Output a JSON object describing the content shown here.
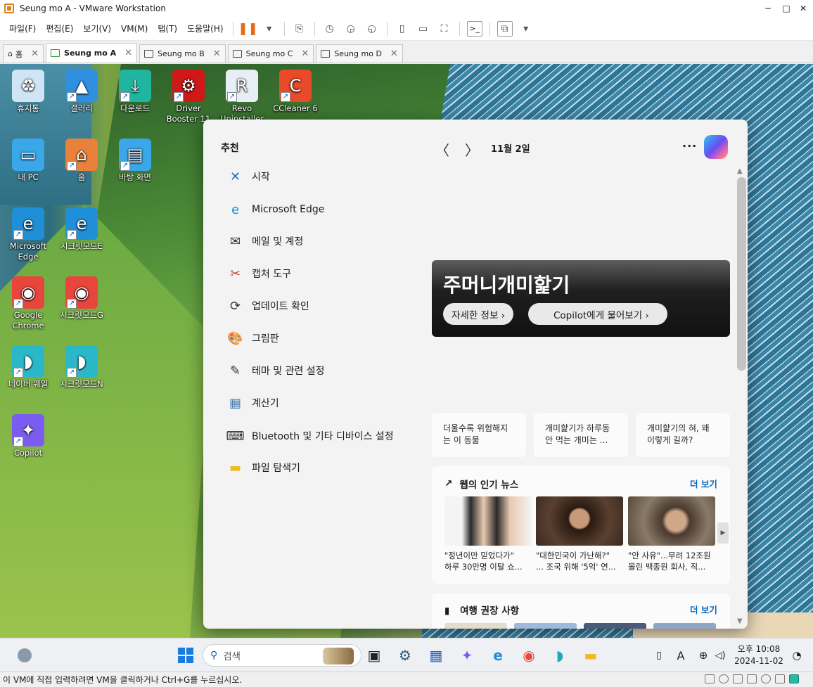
{
  "window": {
    "title": "Seung mo A - VMware Workstation",
    "minimize": "─",
    "maximize": "□",
    "close": "✕"
  },
  "menu": [
    "파일(F)",
    "편집(E)",
    "보기(V)",
    "VM(M)",
    "탭(T)",
    "도움말(H)"
  ],
  "toolbar": {
    "pause": "❚❚",
    "dropdown": "▾",
    "send_keys": "⎘",
    "snapshot": "◷",
    "revert": "◶",
    "manage": "◵",
    "view_full": "▯",
    "view_console": "▭",
    "fit": "⛶",
    "terminal": ">_",
    "unity": "⧉"
  },
  "tabs": [
    {
      "label": "홈",
      "icon": "home-icon"
    },
    {
      "label": "Seung mo A",
      "active": true
    },
    {
      "label": "Seung mo B"
    },
    {
      "label": "Seung mo C"
    },
    {
      "label": "Seung mo D"
    }
  ],
  "desktop_icons": [
    {
      "label": "휴지통",
      "icon": "recycle-bin-icon",
      "color": "#cfe4f4",
      "glyph": "♻"
    },
    {
      "label": "갤러리",
      "icon": "gallery-icon",
      "color": "#2f8fe0",
      "glyph": "▲"
    },
    {
      "label": "다운로드",
      "icon": "downloads-folder-icon",
      "color": "#1fb5a0",
      "glyph": "⤓"
    },
    {
      "label": "Driver Booster 11",
      "icon": "driver-booster-icon",
      "color": "#d01818",
      "glyph": "⚙"
    },
    {
      "label": "Revo Uninstaller",
      "icon": "revo-uninstaller-icon",
      "color": "#e8eef6",
      "glyph": "R"
    },
    {
      "label": "CCleaner 6",
      "icon": "ccleaner-icon",
      "color": "#e84a2a",
      "glyph": "C"
    },
    {
      "label": "내 PC",
      "icon": "this-pc-icon",
      "color": "#39a7e8",
      "glyph": "▭"
    },
    {
      "label": "홈",
      "icon": "home-icon",
      "color": "#e8823a",
      "glyph": "⌂"
    },
    {
      "label": "바탕 화면",
      "icon": "desktop-folder-icon",
      "color": "#39a7e8",
      "glyph": "▤"
    },
    {
      "label": "Microsoft Edge",
      "icon": "edge-icon",
      "color": "#1f8fd8",
      "glyph": "e"
    },
    {
      "label": "시크릿모드E",
      "icon": "edge-incognito-icon",
      "color": "#1f8fd8",
      "glyph": "e"
    },
    {
      "label": "Google Chrome",
      "icon": "chrome-icon",
      "color": "#e8453c",
      "glyph": "◉"
    },
    {
      "label": "시크릿모드G",
      "icon": "chrome-incognito-icon",
      "color": "#e8453c",
      "glyph": "◉"
    },
    {
      "label": "네이버 웨일",
      "icon": "naver-whale-icon",
      "color": "#2ab8c8",
      "glyph": "◗"
    },
    {
      "label": "시크릿모드N",
      "icon": "whale-incognito-icon",
      "color": "#2ab8c8",
      "glyph": "◗"
    },
    {
      "label": "Copilot",
      "icon": "copilot-icon",
      "color": "#7a5cf0",
      "glyph": "✦"
    }
  ],
  "start": {
    "recommended_title": "추천",
    "items": [
      {
        "label": "시작",
        "icon": "get-started-icon",
        "glyph": "✕",
        "color": "#1f6fd0"
      },
      {
        "label": "Microsoft Edge",
        "icon": "edge-icon",
        "glyph": "e",
        "color": "#1f8fd8"
      },
      {
        "label": "메일 및 계정",
        "icon": "mail-icon",
        "glyph": "✉",
        "color": "#333333"
      },
      {
        "label": "캡처 도구",
        "icon": "snipping-tool-icon",
        "glyph": "✂",
        "color": "#d0453a"
      },
      {
        "label": "업데이트 확인",
        "icon": "update-icon",
        "glyph": "⟳",
        "color": "#333333"
      },
      {
        "label": "그림판",
        "icon": "paint-icon",
        "glyph": "🎨",
        "color": "#2b86d8"
      },
      {
        "label": "테마 및 관련 설정",
        "icon": "brush-icon",
        "glyph": "✎",
        "color": "#333333"
      },
      {
        "label": "계산기",
        "icon": "calculator-icon",
        "glyph": "▦",
        "color": "#4a7bb0"
      },
      {
        "label": "Bluetooth 및 기타 디바이스 설정",
        "icon": "keyboard-icon",
        "glyph": "⌨",
        "color": "#333333"
      },
      {
        "label": "파일 탐색기",
        "icon": "file-explorer-icon",
        "glyph": "▬",
        "color": "#f2b728"
      }
    ],
    "date": "11월 2일",
    "more": "···",
    "nav_prev": "〈",
    "nav_next": "〉",
    "hero": {
      "title": "주머니개미핥기",
      "details_button": "자세한 정보 ›",
      "copilot_button": "Copilot에게 물어보기 ›"
    },
    "topics": [
      "더울수록 위험해지는 이 동물",
      "개미핥기가 하루동안 먹는 개미는 ...",
      "개미핥기의 혀, 왜 이렇게 길까?"
    ],
    "news": {
      "title": "웹의 인기 뉴스",
      "more": "더 보기",
      "items": [
        {
          "line1": "\"정년이만 믿었다가\"",
          "line2": "하루 30만명 이탈 쇼...",
          "color": "#f4f4f4"
        },
        {
          "line1": "\"대한민국이 가난해?\"",
          "line2": "... 조국 위해 '5억' 연...",
          "color": "#5a4030"
        },
        {
          "line1": "\"안 사유\"...무려 12조원",
          "line2": "몰린 백종원 회사, 직...",
          "color": "#6a5a48"
        }
      ]
    },
    "travel": {
      "title": "여행 권장 사항",
      "more": "더 보기"
    }
  },
  "taskbar": {
    "search_placeholder": "검색",
    "clock_time": "오후 10:08",
    "clock_date": "2024-11-02",
    "ime": "A",
    "pinned": [
      {
        "icon": "task-view-icon",
        "glyph": "▣",
        "color": "#222222"
      },
      {
        "icon": "settings-icon",
        "glyph": "⚙",
        "color": "#3a5a80"
      },
      {
        "icon": "store-icon",
        "glyph": "▦",
        "color": "#1d64c4"
      },
      {
        "icon": "copilot-icon",
        "glyph": "✦",
        "color": "#7a5cf0"
      },
      {
        "icon": "edge-icon",
        "glyph": "e",
        "color": "#1f8fd8"
      },
      {
        "icon": "chrome-icon",
        "glyph": "◉",
        "color": "#e8453c"
      },
      {
        "icon": "naver-whale-icon",
        "glyph": "◗",
        "color": "#1fa8b8"
      },
      {
        "icon": "file-explorer-icon",
        "glyph": "▬",
        "color": "#f2b728"
      }
    ]
  },
  "status": {
    "hint": "이 VM에 직접 입력하려면 VM을 클릭하거나 Ctrl+G를 누르십시오."
  }
}
